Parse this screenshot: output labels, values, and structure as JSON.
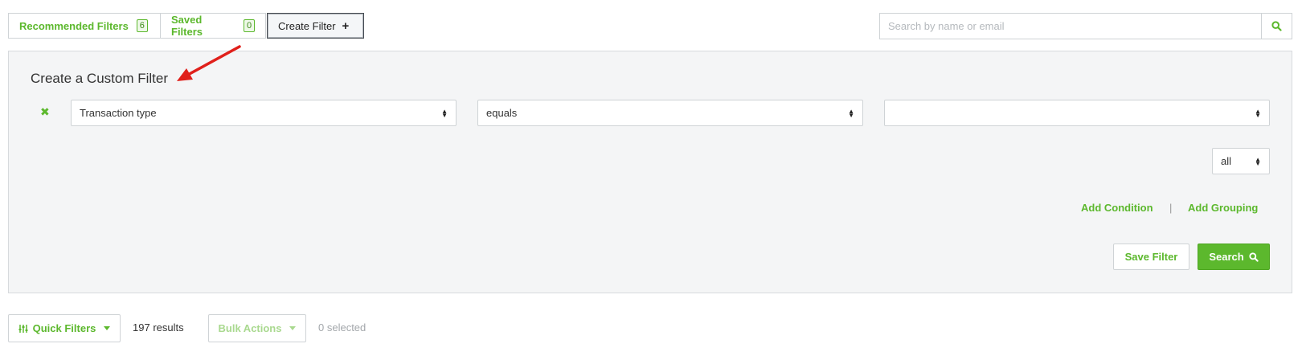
{
  "tabs": {
    "recommended": {
      "label": "Recommended Filters",
      "count": "6"
    },
    "saved": {
      "label": "Saved Filters",
      "count": "0"
    },
    "create": {
      "label": "Create Filter",
      "icon": "plus-icon"
    }
  },
  "search": {
    "placeholder": "Search by name or email",
    "value": ""
  },
  "panel": {
    "title": "Create a Custom Filter",
    "condition": {
      "field": "Transaction type",
      "operator": "equals",
      "value": ""
    },
    "match": "all",
    "add_condition": "Add Condition",
    "separator": "|",
    "add_grouping": "Add Grouping",
    "save_filter": "Save Filter",
    "search_button": "Search"
  },
  "toolbar": {
    "quick_filters": "Quick Filters",
    "results_count": "197",
    "results_label": "results",
    "bulk_actions": "Bulk Actions",
    "selected": "0 selected"
  },
  "colors": {
    "accent": "#5cb82d",
    "annotation_arrow": "#e0201b",
    "panel_bg": "#f4f5f6"
  }
}
